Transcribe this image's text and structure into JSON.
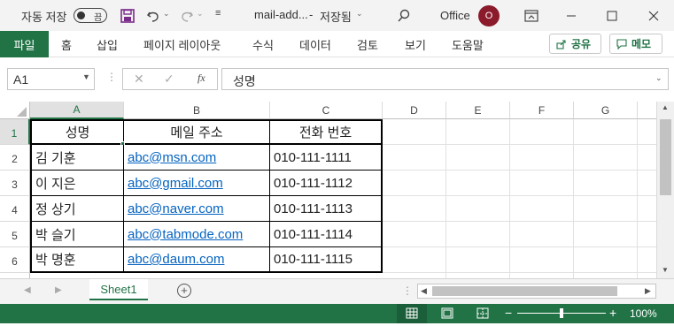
{
  "titlebar": {
    "autosave_label": "자동 저장",
    "autosave_toggle": "끔",
    "filename": "mail-add...",
    "save_state": "저장됨",
    "separator": "-",
    "account": "Office",
    "avatar_initial": "O"
  },
  "ribbon": {
    "file_tab": "파일",
    "tabs": [
      "홈",
      "삽입",
      "페이지 레이아웃",
      "수식",
      "데이터",
      "검토",
      "보기",
      "도움말"
    ],
    "share_label": "공유",
    "comment_label": "메모"
  },
  "formula_bar": {
    "name_box": "A1",
    "fx": "fx",
    "content": "성명"
  },
  "grid": {
    "columns": [
      "A",
      "B",
      "C",
      "D",
      "E",
      "F",
      "G"
    ],
    "rows": [
      "1",
      "2",
      "3",
      "4",
      "5",
      "6"
    ],
    "headers": [
      "성명",
      "메일 주소",
      "전화 번호"
    ],
    "records": [
      {
        "name": "김 기훈",
        "email": "abc@msn.com",
        "phone": "010-111-1111"
      },
      {
        "name": "이 지은",
        "email": "abc@gmail.com",
        "phone": "010-111-1112"
      },
      {
        "name": "정 상기",
        "email": "abc@naver.com",
        "phone": "010-111-1113"
      },
      {
        "name": "박 슬기",
        "email": "abc@tabmode.com",
        "phone": "010-111-1114"
      },
      {
        "name": "박 명훈",
        "email": "abc@daum.com",
        "phone": "010-111-1115"
      }
    ]
  },
  "sheet_tabs": [
    "Sheet1"
  ],
  "status": {
    "zoom": "100%",
    "zoom_minus": "−",
    "zoom_plus": "+"
  },
  "colors": {
    "accent": "#217346",
    "link": "#0563c1",
    "avatar": "#8b1a2b"
  }
}
